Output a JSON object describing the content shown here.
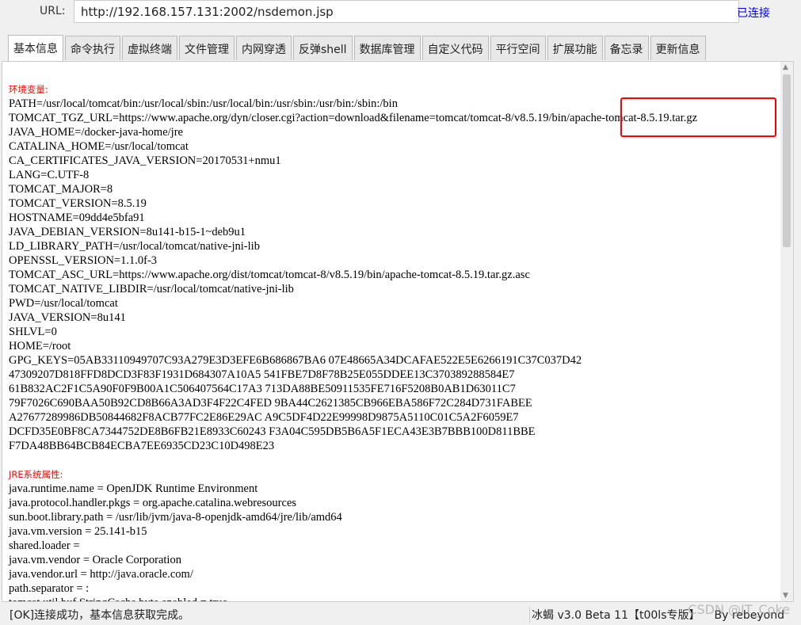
{
  "url_bar": {
    "label": "URL:",
    "value": "http://192.168.157.131:2002/nsdemon.jsp",
    "status": "已连接"
  },
  "tabs": [
    "基本信息",
    "命令执行",
    "虚拟终端",
    "文件管理",
    "内网穿透",
    "反弹shell",
    "数据库管理",
    "自定义代码",
    "平行空间",
    "扩展功能",
    "备忘录",
    "更新信息"
  ],
  "active_tab": "基本信息",
  "env_section": {
    "title": "环境变量:",
    "lines": [
      "PATH=/usr/local/tomcat/bin:/usr/local/sbin:/usr/local/bin:/usr/sbin:/usr/bin:/sbin:/bin",
      "TOMCAT_TGZ_URL=https://www.apache.org/dyn/closer.cgi?action=download&filename=tomcat/tomcat-8/v8.5.19/bin/apache-tomcat-8.5.19.tar.gz",
      "JAVA_HOME=/docker-java-home/jre",
      "CATALINA_HOME=/usr/local/tomcat",
      "CA_CERTIFICATES_JAVA_VERSION=20170531+nmu1",
      "LANG=C.UTF-8",
      "TOMCAT_MAJOR=8",
      "TOMCAT_VERSION=8.5.19",
      "HOSTNAME=09dd4e5bfa91",
      "JAVA_DEBIAN_VERSION=8u141-b15-1~deb9u1",
      "LD_LIBRARY_PATH=/usr/local/tomcat/native-jni-lib",
      "OPENSSL_VERSION=1.1.0f-3",
      "TOMCAT_ASC_URL=https://www.apache.org/dist/tomcat/tomcat-8/v8.5.19/bin/apache-tomcat-8.5.19.tar.gz.asc",
      "TOMCAT_NATIVE_LIBDIR=/usr/local/tomcat/native-jni-lib",
      "PWD=/usr/local/tomcat",
      "JAVA_VERSION=8u141",
      "SHLVL=0",
      "HOME=/root",
      "GPG_KEYS=05AB33110949707C93A279E3D3EFE6B686867BA6 07E48665A34DCAFAE522E5E6266191C37C037D42",
      "47309207D818FFD8DCD3F83F1931D684307A10A5 541FBE7D8F78B25E055DDEE13C370389288584E7",
      "61B832AC2F1C5A90F0F9B00A1C506407564C17A3 713DA88BE50911535FE716F5208B0AB1D63011C7",
      "79F7026C690BAA50B92CD8B66A3AD3F4F22C4FED 9BA44C2621385CB966EBA586F72C284D731FABEE",
      "A27677289986DB50844682F8ACB77FC2E86E29AC A9C5DF4D22E99998D9875A5110C01C5A2F6059E7",
      "DCFD35E0BF8CA7344752DE8B6FB21E8933C60243 F3A04C595DB5B6A5F1ECA43E3B7BBB100D811BBE",
      "F7DA48BB64BCB84ECBA7EE6935CD23C10D498E23"
    ]
  },
  "jre_section": {
    "title": "JRE系统属性:",
    "lines": [
      "java.runtime.name = OpenJDK Runtime Environment",
      "java.protocol.handler.pkgs = org.apache.catalina.webresources",
      "sun.boot.library.path = /usr/lib/jvm/java-8-openjdk-amd64/jre/lib/amd64",
      "java.vm.version = 25.141-b15",
      "shared.loader = ",
      "java.vm.vendor = Oracle Corporation",
      "java.vendor.url = http://java.oracle.com/",
      "path.separator = :",
      "tomcat.util.buf.StringCache.byte.enabled = true"
    ]
  },
  "statusbar": {
    "message": "[OK]连接成功，基本信息获取完成。",
    "version": "冰蝎 v3.0 Beta 11【t00ls专版】",
    "author": "By rebeyond",
    "watermark": "CSDN @IT_Coke"
  },
  "colors": {
    "section_title": "#ff0000",
    "highlight_box": "#ff0000",
    "link": "#0000ee"
  }
}
